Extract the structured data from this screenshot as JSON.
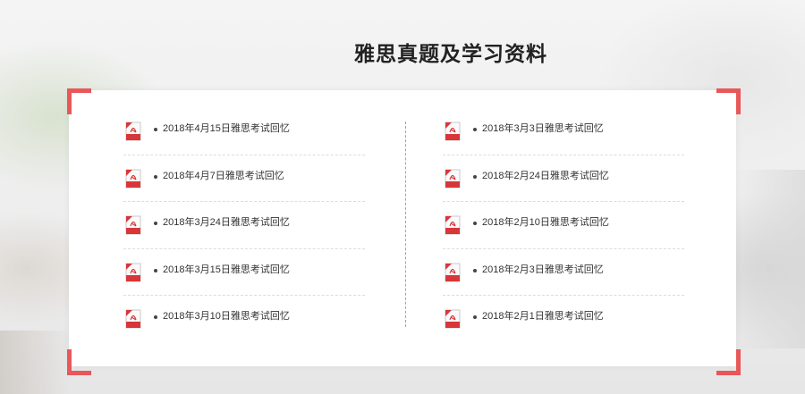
{
  "section": {
    "title": "雅思真题及学习资料"
  },
  "colors": {
    "accent": "#e8575a",
    "divider": "#e3878a",
    "text": "#333333"
  },
  "left_list": [
    {
      "label": "2018年4月15日雅思考试回忆",
      "icon": "pdf-icon"
    },
    {
      "label": "2018年4月7日雅思考试回忆",
      "icon": "pdf-icon"
    },
    {
      "label": "2018年3月24日雅思考试回忆",
      "icon": "pdf-icon"
    },
    {
      "label": "2018年3月15日雅思考试回忆",
      "icon": "pdf-icon"
    },
    {
      "label": "2018年3月10日雅思考试回忆",
      "icon": "pdf-icon"
    }
  ],
  "right_list": [
    {
      "label": "2018年3月3日雅思考试回忆",
      "icon": "pdf-icon"
    },
    {
      "label": "2018年2月24日雅思考试回忆",
      "icon": "pdf-icon"
    },
    {
      "label": "2018年2月10日雅思考试回忆",
      "icon": "pdf-icon"
    },
    {
      "label": "2018年2月3日雅思考试回忆",
      "icon": "pdf-icon"
    },
    {
      "label": "2018年2月1日雅思考试回忆",
      "icon": "pdf-icon"
    }
  ]
}
